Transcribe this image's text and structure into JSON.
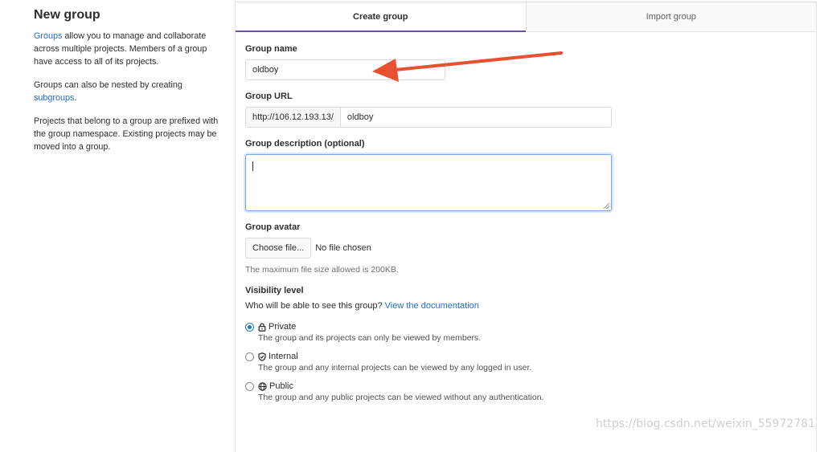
{
  "sidebar": {
    "title": "New group",
    "p1_link": "Groups",
    "p1_text": " allow you to manage and collaborate across multiple projects. Members of a group have access to all of its projects.",
    "p2_text": "Groups can also be nested by creating ",
    "p2_link": "subgroups",
    "p2_end": ".",
    "p3_text": "Projects that belong to a group are prefixed with the group namespace. Existing projects may be moved into a group."
  },
  "tabs": [
    {
      "label": "Create group",
      "active": true
    },
    {
      "label": "Import group",
      "active": false
    }
  ],
  "form": {
    "group_name_label": "Group name",
    "group_name_value": "oldboy",
    "group_url_label": "Group URL",
    "group_url_prefix": "http://106.12.193.13/",
    "group_url_value": "oldboy",
    "description_label": "Group description (optional)",
    "avatar_label": "Group avatar",
    "choose_file_label": "Choose file...",
    "no_file_text": "No file chosen",
    "avatar_help": "The maximum file size allowed is 200KB.",
    "visibility_label": "Visibility level",
    "visibility_question": "Who will be able to see this group?",
    "visibility_doc_link": "View the documentation",
    "options": [
      {
        "title": "Private",
        "desc": "The group and its projects can only be viewed by members.",
        "icon": "lock-icon",
        "checked": true
      },
      {
        "title": "Internal",
        "desc": "The group and any internal projects can be viewed by any logged in user.",
        "icon": "shield-icon",
        "checked": false
      },
      {
        "title": "Public",
        "desc": "The group and any public projects can be viewed without any authentication.",
        "icon": "globe-icon",
        "checked": false
      }
    ]
  },
  "watermark": "https://blog.csdn.net/weixin_55972781",
  "colors": {
    "link": "#1f6fd1",
    "tab_active_underline": "#6b4fbb",
    "annotation_arrow": "#e9502f",
    "radio_checked": "#1f78d1"
  }
}
